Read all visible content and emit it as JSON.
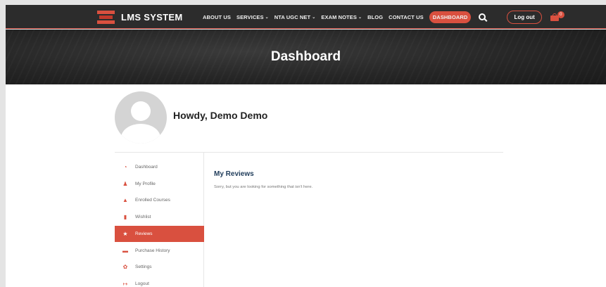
{
  "header": {
    "logo_text": "LMS SYSTEM",
    "nav": [
      {
        "label": "ABOUT US",
        "has_dropdown": false
      },
      {
        "label": "SERVICES",
        "has_dropdown": true
      },
      {
        "label": "NTA UGC NET",
        "has_dropdown": true
      },
      {
        "label": "EXAM NOTES",
        "has_dropdown": true
      },
      {
        "label": "BLOG",
        "has_dropdown": false
      },
      {
        "label": "CONTACT US",
        "has_dropdown": false
      },
      {
        "label": "DASHBOARD",
        "has_dropdown": false,
        "active": true
      }
    ],
    "search_icon": "search-icon",
    "logout_label": "Log out",
    "cart_count": "0",
    "accent_color": "#d9503f"
  },
  "hero": {
    "title": "Dashboard"
  },
  "profile": {
    "greeting": "Howdy, Demo Demo"
  },
  "sidebar": {
    "items": [
      {
        "label": "Dashboard",
        "icon": "dashboard-icon"
      },
      {
        "label": "My Profile",
        "icon": "user-icon"
      },
      {
        "label": "Enrolled Courses",
        "icon": "graduation-cap-icon"
      },
      {
        "label": "Wishlist",
        "icon": "bookmark-icon"
      },
      {
        "label": "Reviews",
        "icon": "star-icon",
        "active": true
      },
      {
        "label": "Purchase History",
        "icon": "cart-icon"
      },
      {
        "label": "Settings",
        "icon": "gear-icon"
      },
      {
        "label": "Logout",
        "icon": "logout-icon"
      }
    ]
  },
  "main": {
    "title": "My Reviews",
    "message": "Sorry, but you are looking for something that isn't here."
  }
}
